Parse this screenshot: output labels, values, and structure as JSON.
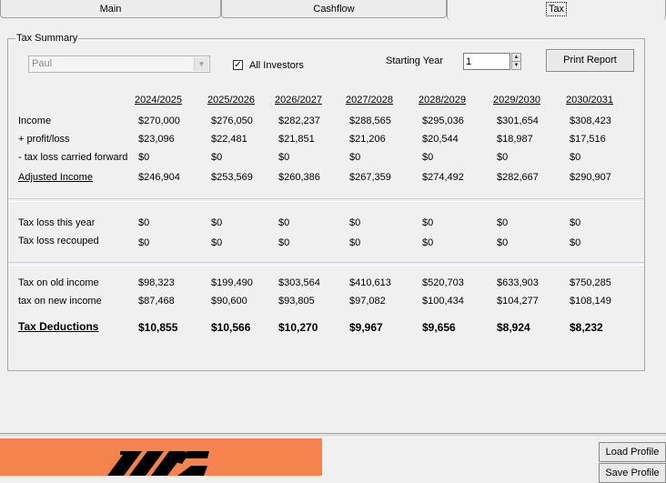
{
  "tabs": [
    {
      "label": "Main",
      "active": false
    },
    {
      "label": "Cashflow",
      "active": false
    },
    {
      "label": "Tax",
      "active": true
    }
  ],
  "group_title": "Tax Summary",
  "investor_select": {
    "value": "Paul"
  },
  "all_investors": {
    "label": "All Investors",
    "checked": true
  },
  "starting_year": {
    "label": "Starting Year",
    "value": "1"
  },
  "print_report_label": "Print Report",
  "years": [
    "2024/2025",
    "2025/2026",
    "2026/2027",
    "2027/2028",
    "2028/2029",
    "2029/2030",
    "2030/2031"
  ],
  "rows": {
    "income": {
      "label": "Income",
      "values": [
        "$270,000",
        "$276,050",
        "$282,237",
        "$288,565",
        "$295,036",
        "$301,654",
        "$308,423"
      ]
    },
    "profit_loss": {
      "label": "+ profit/loss",
      "values": [
        "$23,096",
        "$22,481",
        "$21,851",
        "$21,206",
        "$20,544",
        "$18,987",
        "$17,516"
      ]
    },
    "tax_loss_cf": {
      "label": "- tax loss carried forward",
      "values": [
        "$0",
        "$0",
        "$0",
        "$0",
        "$0",
        "$0",
        "$0"
      ]
    },
    "adjusted_income": {
      "label": "Adjusted Income",
      "values": [
        "$246,904",
        "$253,569",
        "$260,386",
        "$267,359",
        "$274,492",
        "$282,667",
        "$290,907"
      ]
    },
    "tax_loss_year": {
      "label": "Tax loss this year",
      "values": [
        "$0",
        "$0",
        "$0",
        "$0",
        "$0",
        "$0",
        "$0"
      ]
    },
    "tax_loss_recouped": {
      "label": "Tax loss recouped",
      "values": [
        "$0",
        "$0",
        "$0",
        "$0",
        "$0",
        "$0",
        "$0"
      ]
    },
    "tax_old_income": {
      "label": "Tax on old income",
      "values": [
        "$98,323",
        "$199,490",
        "$303,564",
        "$410,613",
        "$520,703",
        "$633,903",
        "$750,285"
      ]
    },
    "tax_new_income": {
      "label": "tax on new income",
      "values": [
        "$87,468",
        "$90,600",
        "$93,805",
        "$97,082",
        "$100,434",
        "$104,277",
        "$108,149"
      ]
    },
    "tax_deductions": {
      "label": "Tax Deductions",
      "values": [
        "$10,855",
        "$10,566",
        "$10,270",
        "$9,967",
        "$9,656",
        "$8,924",
        "$8,232"
      ]
    }
  },
  "load_profile_label": "Load Profile",
  "save_profile_label": "Save Profile",
  "colors": {
    "banner": "#f4834e",
    "background": "#f0f0f0"
  }
}
